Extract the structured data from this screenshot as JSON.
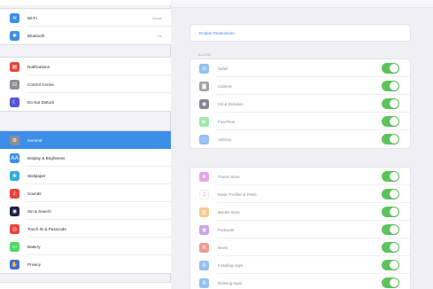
{
  "sidebar": {
    "group1": [
      {
        "label": "Wi-Fi",
        "value": "Home",
        "icon": "wifi-icon",
        "color": "#3d8ee8",
        "glyph": "≋"
      },
      {
        "label": "Bluetooth",
        "value": "On",
        "icon": "bluetooth-icon",
        "color": "#3d8ee8",
        "glyph": "✱"
      }
    ],
    "group2": [
      {
        "label": "Notifications",
        "icon": "notifications-icon",
        "color": "#e8453c",
        "glyph": "▤"
      },
      {
        "label": "Control Centre",
        "icon": "control-centre-icon",
        "color": "#8e8e93",
        "glyph": "⊟"
      },
      {
        "label": "Do Not Disturb",
        "icon": "moon-icon",
        "color": "#5856d6",
        "glyph": "☾"
      }
    ],
    "group3": [
      {
        "label": "General",
        "icon": "gear-icon",
        "color": "#8e8e93",
        "glyph": "⚙",
        "selected": true
      },
      {
        "label": "Display & Brightness",
        "icon": "display-icon",
        "color": "#3d8ee8",
        "glyph": "AA"
      },
      {
        "label": "Wallpaper",
        "icon": "wallpaper-icon",
        "color": "#35aadc",
        "glyph": "❀"
      },
      {
        "label": "Sounds",
        "icon": "speaker-icon",
        "color": "#e8453c",
        "glyph": "♪"
      },
      {
        "label": "Siri & Search",
        "icon": "siri-icon",
        "color": "#222244",
        "glyph": "◉"
      },
      {
        "label": "Touch ID & Passcode",
        "icon": "fingerprint-icon",
        "color": "#e8453c",
        "glyph": "◎"
      },
      {
        "label": "Battery",
        "icon": "battery-icon",
        "color": "#4cd964",
        "glyph": "▭"
      },
      {
        "label": "Privacy",
        "icon": "hand-icon",
        "color": "#3d6fd8",
        "glyph": "✋"
      }
    ]
  },
  "main": {
    "enable_label": "Enable Restrictions",
    "section_label": "ALLOW:",
    "allow_items": [
      {
        "label": "Safari",
        "icon": "safari-icon",
        "color": "#3d8ee8",
        "glyph": "◎",
        "on": true
      },
      {
        "label": "Camera",
        "icon": "camera-icon",
        "color": "#555555",
        "glyph": "◙",
        "on": true
      },
      {
        "label": "Siri & Dictation",
        "icon": "siri-icon",
        "color": "#222244",
        "glyph": "◉",
        "on": true
      },
      {
        "label": "FaceTime",
        "icon": "facetime-icon",
        "color": "#4cd964",
        "glyph": "▶",
        "on": true
      },
      {
        "label": "AirDrop",
        "icon": "airdrop-icon",
        "color": "#3d8ee8",
        "glyph": "◌",
        "on": true
      }
    ],
    "app_items": [
      {
        "label": "iTunes Store",
        "icon": "itunes-store-icon",
        "color": "#d05ad8",
        "glyph": "★",
        "on": true
      },
      {
        "label": "Music Profiles & Posts",
        "icon": "music-icon",
        "color": "#ffffff",
        "glyph": "♫",
        "glyph_color": "#e8453c",
        "on": true
      },
      {
        "label": "iBooks Store",
        "icon": "ibooks-icon",
        "color": "#f39c2b",
        "glyph": "▥",
        "on": true
      },
      {
        "label": "Podcasts",
        "icon": "podcasts-icon",
        "color": "#a35ad8",
        "glyph": "◉",
        "on": true
      },
      {
        "label": "News",
        "icon": "news-icon",
        "color": "#e8453c",
        "glyph": "N",
        "on": true
      },
      {
        "label": "Installing Apps",
        "icon": "app-store-icon",
        "color": "#3d8ee8",
        "glyph": "A",
        "on": true
      },
      {
        "label": "Deleting Apps",
        "icon": "app-store-icon",
        "color": "#3d8ee8",
        "glyph": "A",
        "on": true
      }
    ]
  }
}
